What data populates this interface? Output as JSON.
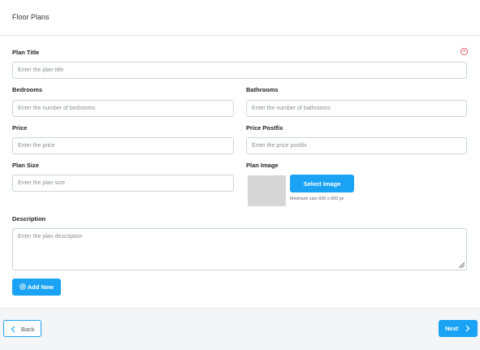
{
  "header": {
    "title": "Floor Plans"
  },
  "form": {
    "plan_title": {
      "label": "Plan Title",
      "placeholder": "Enter the plan title",
      "value": ""
    },
    "bedrooms": {
      "label": "Bedrooms",
      "placeholder": "Enter the number of bedrooms",
      "value": ""
    },
    "bathrooms": {
      "label": "Bathrooms",
      "placeholder": "Enter the number of bathrooms",
      "value": ""
    },
    "price": {
      "label": "Price",
      "placeholder": "Enter the price",
      "value": ""
    },
    "price_postfix": {
      "label": "Price Postfix",
      "placeholder": "Enter the price postfix",
      "value": ""
    },
    "plan_size": {
      "label": "Plan Size",
      "placeholder": "Enter the plan size",
      "value": ""
    },
    "plan_image": {
      "label": "Plan Image",
      "select_label": "Select Image",
      "hint": "Minimum size 600 x 600 px"
    },
    "description": {
      "label": "Description",
      "placeholder": "Enter the plan description",
      "value": ""
    },
    "add_new_label": "Add New",
    "remove_icon": "close-circle-icon"
  },
  "footer": {
    "back_label": "Back",
    "next_label": "Next"
  },
  "colors": {
    "accent": "#1aa3f5",
    "remove": "#e25c5c",
    "border": "#cfd4da",
    "placeholder_image": "#d6d6d6",
    "page_bg": "#f4f5f7"
  }
}
